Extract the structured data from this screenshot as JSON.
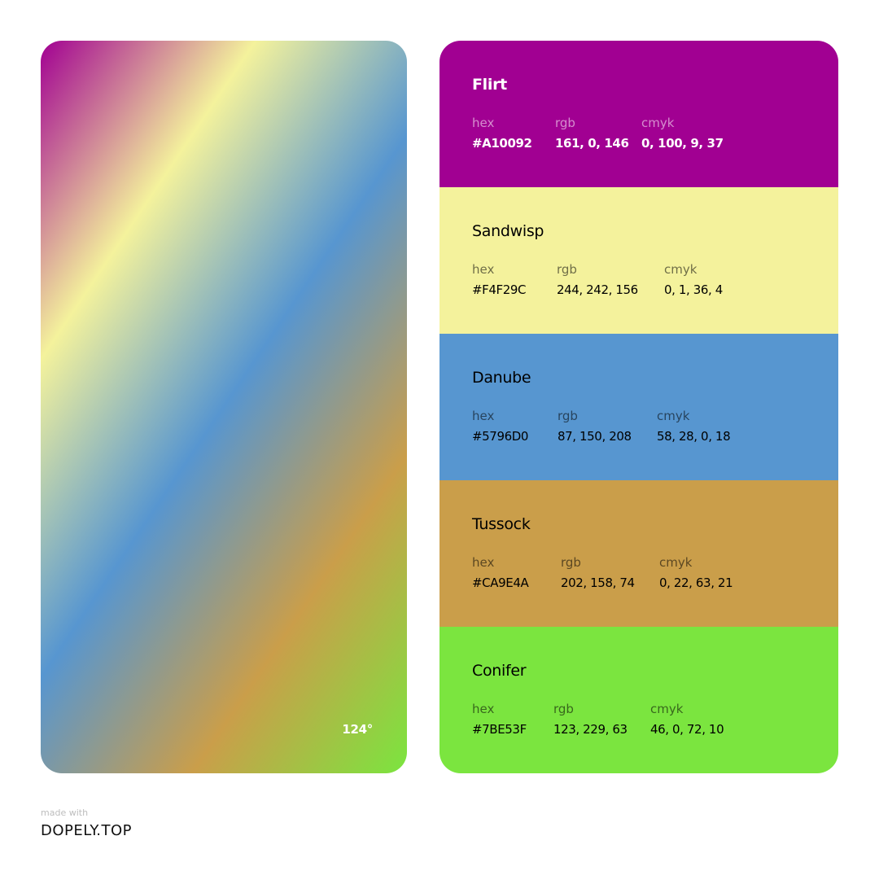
{
  "gradient": {
    "angle_label": "124°",
    "angle_deg": 124,
    "stops": [
      "#A10092",
      "#F4F29C",
      "#5796D0",
      "#CA9E4A",
      "#7BE53F"
    ]
  },
  "palette": [
    {
      "name": "Flirt",
      "color": "#A10092",
      "text_color": "#ffffff",
      "hex_label": "hex",
      "hex": "#A10092",
      "rgb_label": "rgb",
      "rgb": "161, 0, 146",
      "cmyk_label": "cmyk",
      "cmyk": "0, 100, 9, 37"
    },
    {
      "name": "Sandwisp",
      "color": "#F4F29C",
      "text_color": "#000000",
      "hex_label": "hex",
      "hex": "#F4F29C",
      "rgb_label": "rgb",
      "rgb": "244, 242, 156",
      "cmyk_label": "cmyk",
      "cmyk": "0, 1, 36, 4"
    },
    {
      "name": "Danube",
      "color": "#5796D0",
      "text_color": "#000000",
      "hex_label": "hex",
      "hex": "#5796D0",
      "rgb_label": "rgb",
      "rgb": "87, 150, 208",
      "cmyk_label": "cmyk",
      "cmyk": "58, 28, 0, 18"
    },
    {
      "name": "Tussock",
      "color": "#CA9E4A",
      "text_color": "#000000",
      "hex_label": "hex",
      "hex": "#CA9E4A",
      "rgb_label": "rgb",
      "rgb": "202, 158, 74",
      "cmyk_label": "cmyk",
      "cmyk": "0, 22, 63, 21"
    },
    {
      "name": "Conifer",
      "color": "#7BE53F",
      "text_color": "#000000",
      "hex_label": "hex",
      "hex": "#7BE53F",
      "rgb_label": "rgb",
      "rgb": "123, 229, 63",
      "cmyk_label": "cmyk",
      "cmyk": "46, 0, 72, 10"
    }
  ],
  "footer": {
    "made_with": "made with",
    "brand": "DOPELY.TOP"
  }
}
